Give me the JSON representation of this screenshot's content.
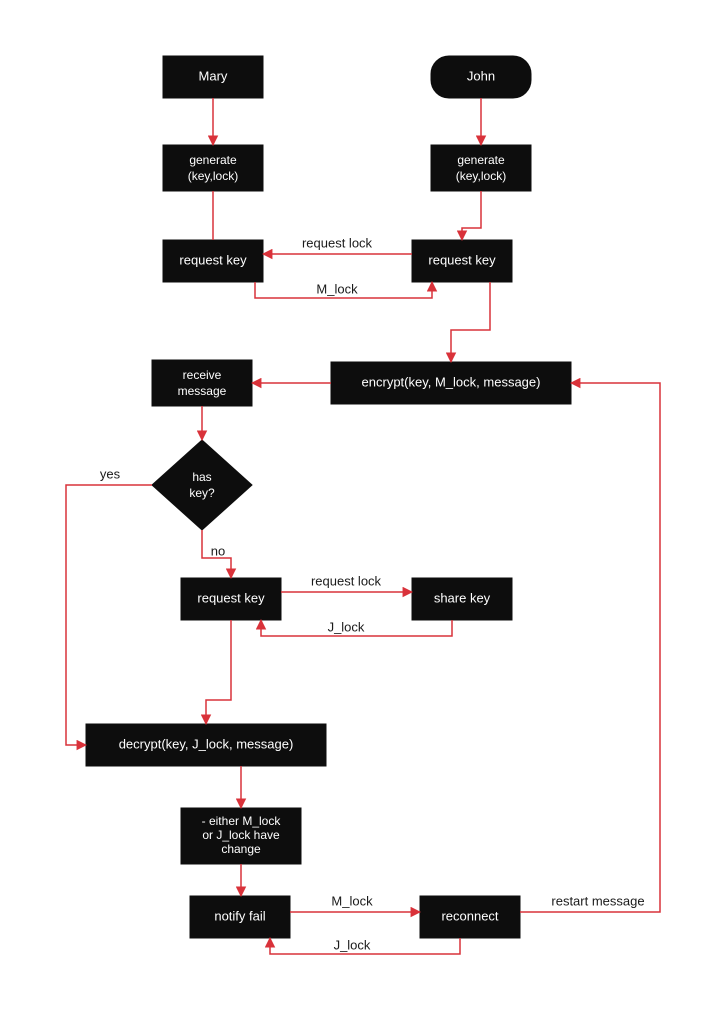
{
  "diagram": {
    "type": "flowchart",
    "colors": {
      "node_fill": "#0d0d0d",
      "node_text": "#ffffff",
      "edge": "#d9323a"
    },
    "nodes": {
      "mary": {
        "label": "Mary",
        "shape": "rect"
      },
      "john": {
        "label": "John",
        "shape": "round-rect"
      },
      "gen_m": {
        "line1": "generate",
        "line2": "(key,lock)",
        "shape": "rect"
      },
      "gen_j": {
        "line1": "generate",
        "line2": "(key,lock)",
        "shape": "rect"
      },
      "reqkey_m": {
        "label": "request key",
        "shape": "rect"
      },
      "reqkey_j": {
        "label": "request key",
        "shape": "rect"
      },
      "recvmsg": {
        "line1": "receive",
        "line2": "message",
        "shape": "rect"
      },
      "encrypt": {
        "label": "encrypt(key, M_lock, message)",
        "shape": "rect"
      },
      "haskey": {
        "line1": "has",
        "line2": "key?",
        "shape": "diamond"
      },
      "reqkey2": {
        "label": "request key",
        "shape": "rect"
      },
      "sharekey": {
        "label": "share key",
        "shape": "rect"
      },
      "decrypt": {
        "label": "decrypt(key, J_lock, message)",
        "shape": "rect"
      },
      "lockchange": {
        "line1": "- either M_lock",
        "line2": "or J_lock have",
        "line3": "change",
        "shape": "rect"
      },
      "notifyfail": {
        "label": "notify fail",
        "shape": "rect"
      },
      "reconnect": {
        "label": "reconnect",
        "shape": "rect"
      }
    },
    "edges": {
      "e1": {
        "label": ""
      },
      "e2": {
        "label": ""
      },
      "e3": {
        "label": ""
      },
      "e4": {
        "label": ""
      },
      "e5": {
        "label": "request lock"
      },
      "e6": {
        "label": "M_lock"
      },
      "e7": {
        "label": ""
      },
      "e8": {
        "label": ""
      },
      "e9": {
        "label": ""
      },
      "e10": {
        "label": "yes"
      },
      "e11": {
        "label": "no"
      },
      "e12": {
        "label": "request lock"
      },
      "e13": {
        "label": "J_lock"
      },
      "e14": {
        "label": ""
      },
      "e15": {
        "label": ""
      },
      "e16": {
        "label": ""
      },
      "e17": {
        "label": "M_lock"
      },
      "e18": {
        "label": "J_lock"
      },
      "e19": {
        "label": "restart message"
      },
      "e20": {
        "label": ""
      }
    }
  }
}
